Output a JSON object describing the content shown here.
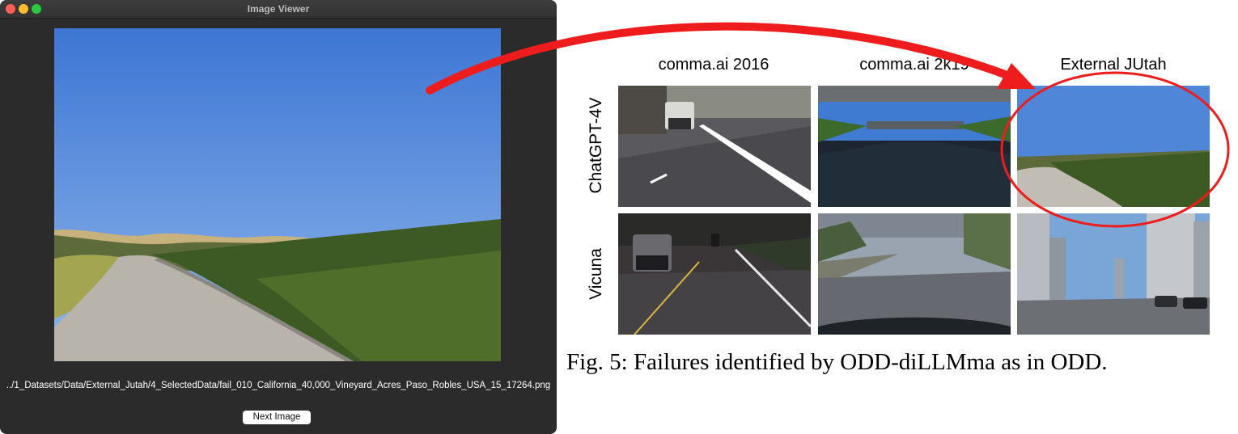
{
  "window": {
    "title": "Image Viewer",
    "file_path": "../1_Datasets/Data/External_Jutah/4_SelectedData/fail_010_California_40,000_Vineyard_Acres_Paso_Robles_USA_15_17264.png",
    "next_button": "Next Image"
  },
  "figure": {
    "columns": [
      "comma.ai 2016",
      "comma.ai 2k19",
      "External JUtah"
    ],
    "rows": [
      "ChatGPT-4V",
      "Vicuna"
    ],
    "caption": "Fig. 5: Failures identified by ODD-diLLMma as in ODD."
  },
  "colors": {
    "annotation_red": "#ee1c1c",
    "window_bg": "#2b2b2b",
    "sky": "#4f86d8"
  }
}
